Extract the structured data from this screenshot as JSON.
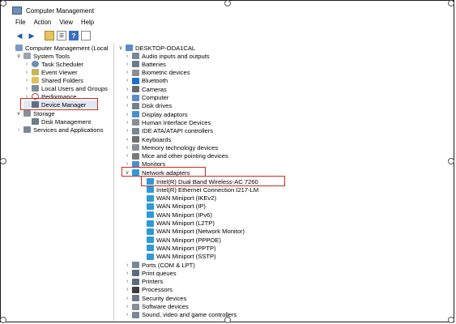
{
  "window": {
    "title": "Computer Management"
  },
  "menu": [
    "File",
    "Action",
    "View",
    "Help"
  ],
  "toolbar": {
    "icons": [
      "back-arrow-icon",
      "forward-arrow-icon",
      "folder-up-icon",
      "properties-icon",
      "help-icon",
      "panel-icon"
    ]
  },
  "tree": {
    "root": "Computer Management (Local",
    "system_tools": "System Tools",
    "items": [
      "Task Scheduler",
      "Event Viewer",
      "Shared Folders",
      "Local Users and Groups",
      "Performance",
      "Device Manager"
    ],
    "storage": "Storage",
    "disk_management": "Disk Management",
    "services": "Services and Applications"
  },
  "devices": {
    "computer_name": "DESKTOP-ODA1CAL",
    "categories_top": [
      "Audio inputs and outputs",
      "Batteries",
      "Biometric devices",
      "Bluetooth",
      "Cameras",
      "Computer",
      "Disk drives",
      "Display adaptors",
      "Human Interface Devices",
      "IDE ATA/ATAPI controllers",
      "Keyboards",
      "Memory technology devices",
      "Mice and other pointing devices",
      "Monitors"
    ],
    "network_adapters": "Network adapters",
    "network_items": [
      "Intel(R) Dual Band Wireless-AC 7260",
      "Intel(R) Ethernet Connection I217-LM",
      "WAN Miniport (IKEv2)",
      "WAN Miniport (IP)",
      "WAN Miniport (IPv6)",
      "WAN Miniport (L2TP)",
      "WAN Miniport (Network Monitor)",
      "WAN Miniport (PPPOE)",
      "WAN Miniport (PPTP)",
      "WAN Miniport (SSTP)"
    ],
    "categories_bottom": [
      "Ports (COM & LPT)",
      "Print queues",
      "Printers",
      "Processors",
      "Security devices",
      "Software devices",
      "Sound, video and game controllers"
    ]
  },
  "colors": {
    "highlight": "#d0281c",
    "adapter_icon": "#2f9ad6",
    "selection": "#dfe9f5"
  }
}
